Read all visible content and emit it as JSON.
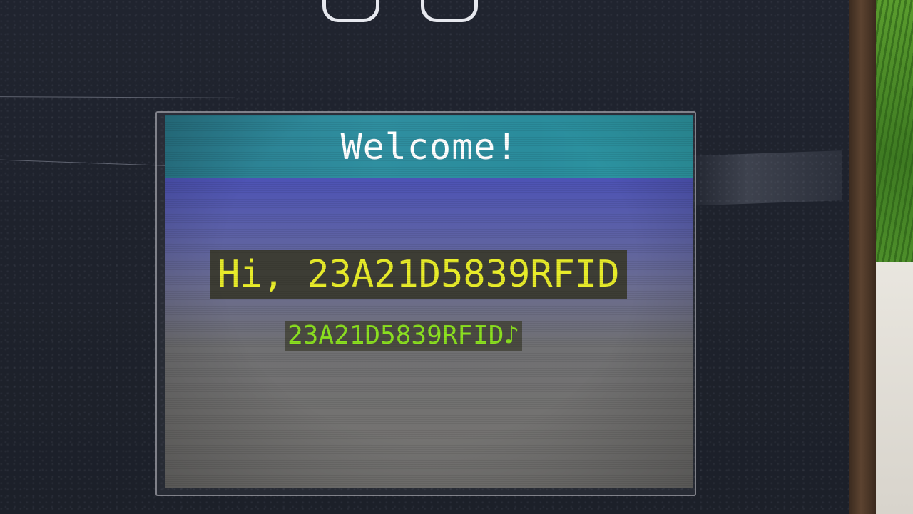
{
  "display": {
    "title": "Welcome!",
    "greeting": "Hi, 23A21D5839RFID",
    "card_id": "23A21D5839RFID♪"
  },
  "colors": {
    "title_bar": "#2f8fa0",
    "greeting_text": "#e8ec2a",
    "card_id_text": "#8be020"
  }
}
